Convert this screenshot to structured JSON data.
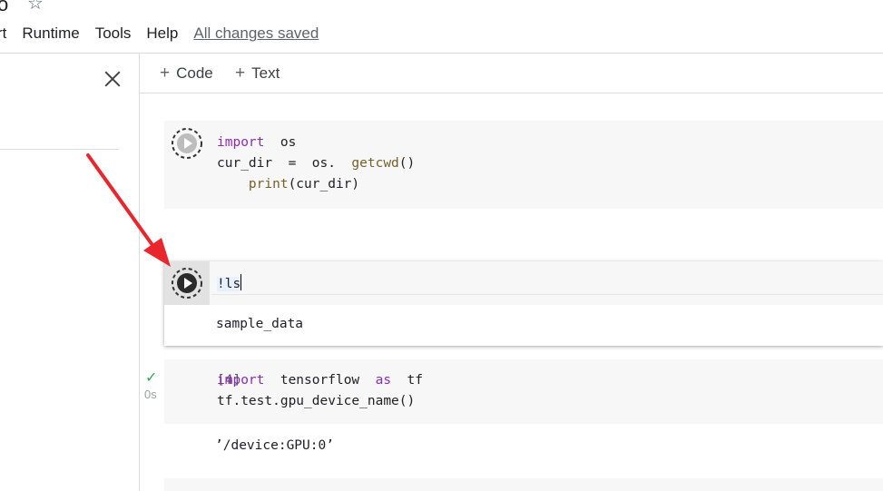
{
  "header": {
    "title_fragment": "o",
    "star_icon": "star-outline-icon",
    "menu": [
      "rt",
      "Runtime",
      "Tools",
      "Help"
    ],
    "save_status": "All changes saved"
  },
  "toolbar": {
    "add_code_label": "Code",
    "add_text_label": "Text"
  },
  "cells": [
    {
      "lines": [
        [
          {
            "t": "import",
            "c": "kw"
          },
          {
            "t": "  os",
            "c": ""
          }
        ],
        [
          {
            "t": "cur_dir  =  os.  ",
            "c": ""
          },
          {
            "t": "getcwd",
            "c": "fn"
          },
          {
            "t": "()",
            "c": ""
          }
        ],
        [
          {
            "t": "    ",
            "c": ""
          },
          {
            "t": "print",
            "c": "fn"
          },
          {
            "t": "(cur_dir)",
            "c": ""
          }
        ]
      ]
    },
    {
      "command": "!ls",
      "output": "sample_data"
    },
    {
      "exec_count": "[4]",
      "exec_status": "✓",
      "exec_time": "0s",
      "lines": [
        [
          {
            "t": "import",
            "c": "kw"
          },
          {
            "t": "  tensorflow  ",
            "c": ""
          },
          {
            "t": "as",
            "c": "kw"
          },
          {
            "t": "  tf",
            "c": ""
          }
        ],
        [
          {
            "t": "tf.test.gpu_device_name()",
            "c": ""
          }
        ]
      ],
      "output": "’/device:GPU:0’"
    }
  ],
  "colors": {
    "keyword": "#8b2bb9",
    "function": "#795e26",
    "annotation_arrow": "#e8262b",
    "success": "#34a853"
  }
}
